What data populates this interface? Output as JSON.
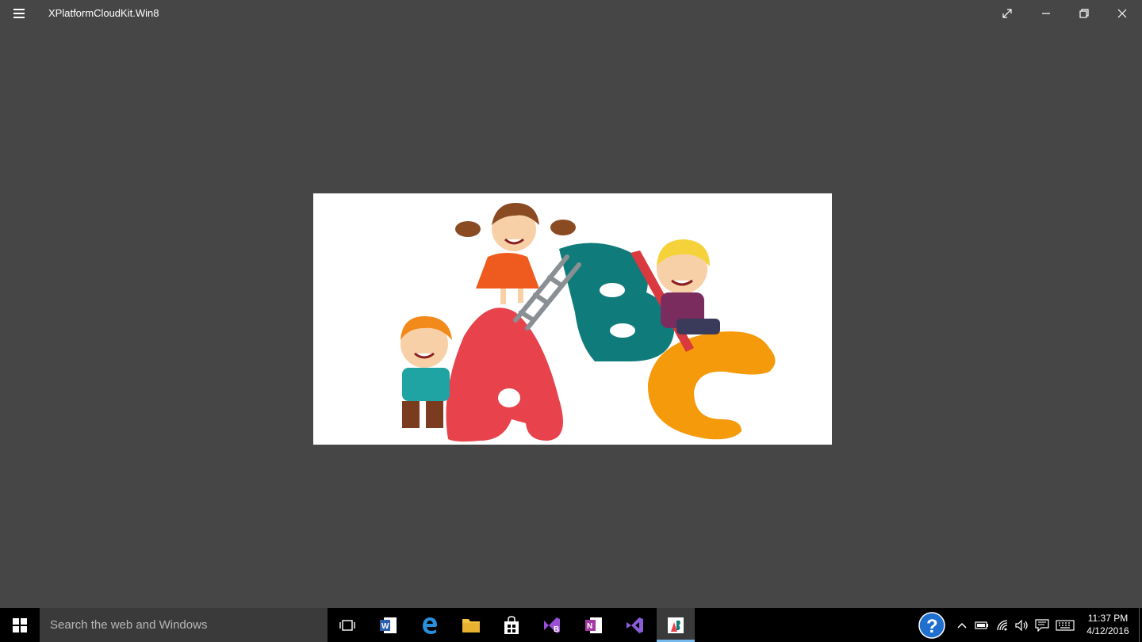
{
  "window": {
    "title": "XPlatformCloudKit.Win8"
  },
  "taskbar": {
    "search_placeholder": "Search the web and Windows",
    "apps": [
      {
        "name": "Task View"
      },
      {
        "name": "Word"
      },
      {
        "name": "Edge"
      },
      {
        "name": "File Explorer"
      },
      {
        "name": "Store"
      },
      {
        "name": "Visual Studio Blend"
      },
      {
        "name": "OneNote"
      },
      {
        "name": "Visual Studio"
      },
      {
        "name": "XPlatformCloudKit"
      }
    ],
    "tray": {
      "time": "11:37 PM",
      "date": "4/12/2016"
    }
  },
  "colors": {
    "background": "#464646",
    "taskbar": "#000000",
    "accent": "#76b9ed"
  }
}
